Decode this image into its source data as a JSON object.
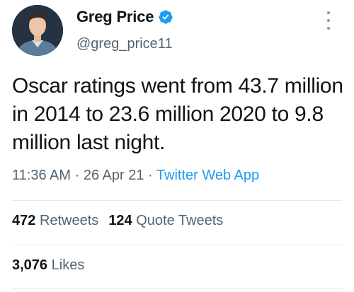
{
  "user": {
    "display_name": "Greg Price",
    "handle": "@greg_price11",
    "verified": true
  },
  "tweet": {
    "text": "Oscar ratings went from 43.7 million in 2014 to 23.6 million 2020 to 9.8 million last night.",
    "time": "11:36 AM",
    "separator1": "·",
    "date": "26 Apr 21",
    "separator2": "·",
    "source": "Twitter Web App"
  },
  "stats": {
    "retweets_count": "472",
    "retweets_label": "Retweets",
    "quotes_count": "124",
    "quotes_label": "Quote Tweets",
    "likes_count": "3,076",
    "likes_label": "Likes"
  },
  "icons": {
    "verified": "verified-badge-icon",
    "more": "more-options-icon"
  },
  "colors": {
    "accent": "#1d9bf0",
    "muted": "#536471",
    "text": "#0f1419",
    "divider": "#e1e8ed"
  }
}
